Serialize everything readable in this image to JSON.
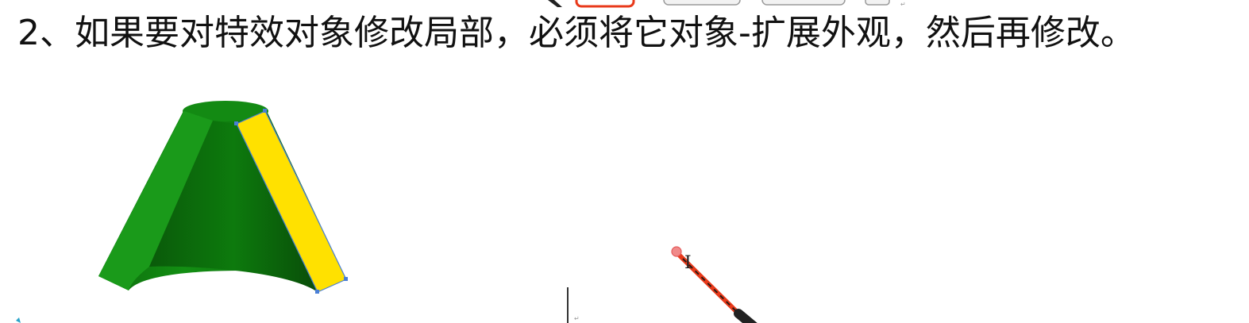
{
  "heading": {
    "text": "2、如果要对特效对象修改局部，必须将它对象-扩展外观，然后再修改。"
  },
  "colors": {
    "cone_dark": "#0a5c0a",
    "cone_mid": "#138a13",
    "cone_light": "#1a9e1a",
    "stripe": "#ffe100",
    "selection": "#4a7fd6",
    "pen_red": "#e8391a",
    "pen_body": "#222222"
  },
  "icons": {
    "pointer": "laser-pointer-icon",
    "cursor": "text-cursor-icon"
  },
  "cursor_glyph": "I"
}
